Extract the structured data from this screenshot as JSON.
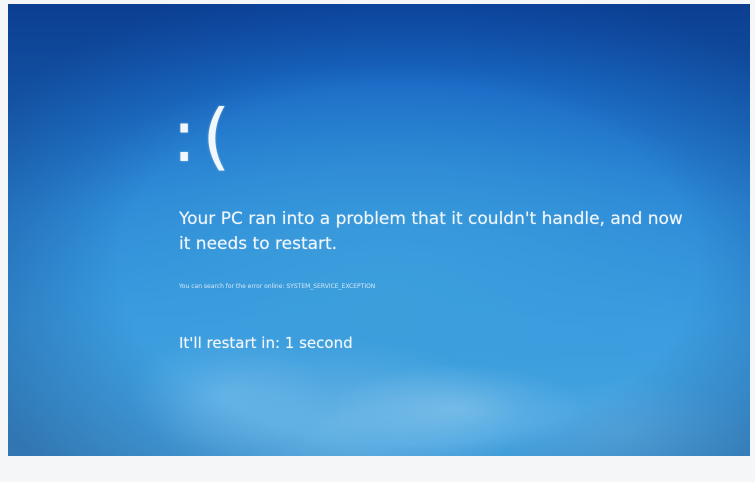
{
  "bsod": {
    "sad_face": ":(",
    "message": "Your PC ran into a problem that it couldn't handle, and now it needs to restart.",
    "search_hint": "You can search for the error online:",
    "error_code": "SYSTEM_SERVICE_EXCEPTION",
    "restart_text": "It'll restart in: 1 second"
  },
  "colors": {
    "background_top": "#0f4fae",
    "background_bottom": "#4aa7e2",
    "text": "#f2f7fc"
  }
}
